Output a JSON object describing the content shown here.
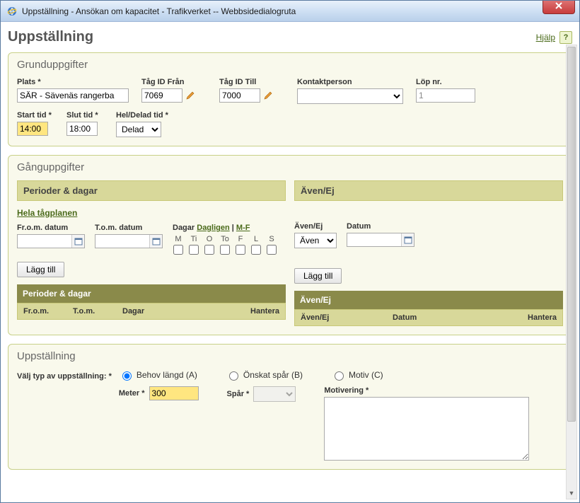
{
  "window": {
    "title": "Uppställning - Ansökan om kapacitet - Trafikverket -- Webbsidedialogruta",
    "close_label": "x"
  },
  "header": {
    "title": "Uppställning",
    "help_link": "Hjälp",
    "help_btn": "?"
  },
  "grund": {
    "legend": "Grunduppgifter",
    "plats_label": "Plats *",
    "plats_value": "SÄR - Sävenäs rangerba",
    "tag_fran_label": "Tåg ID Från",
    "tag_fran_value": "7069",
    "tag_till_label": "Tåg ID Till",
    "tag_till_value": "7000",
    "kontakt_label": "Kontaktperson",
    "kontakt_value": "",
    "lop_label": "Löp nr.",
    "lop_value": "1",
    "start_label": "Start tid *",
    "start_value": "14:00",
    "slut_label": "Slut tid *",
    "slut_value": "18:00",
    "heldelad_label": "Hel/Delad tid *",
    "heldelad_value": "Delad"
  },
  "gang": {
    "legend": "Gånguppgifter",
    "perioder_head": "Perioder & dagar",
    "avenej_head": "Även/Ej",
    "whole_plan": "Hela tågplanen",
    "from_label": "Fr.o.m. datum",
    "tom_label": "T.o.m. datum",
    "dagar_label": "Dagar",
    "dagligen": "Dagligen",
    "mf": "M-F",
    "days": [
      "M",
      "Ti",
      "O",
      "To",
      "F",
      "L",
      "S"
    ],
    "lagg_till": "Lägg till",
    "avenej_label": "Även/Ej",
    "avenej_value": "Även",
    "datum_label": "Datum",
    "grid_left_title": "Perioder & dagar",
    "grid_left_cols": {
      "c1": "Fr.o.m.",
      "c2": "T.o.m.",
      "c3": "Dagar",
      "c4": "Hantera"
    },
    "grid_right_title": "Även/Ej",
    "grid_right_cols": {
      "c1": "Även/Ej",
      "c2": "Datum",
      "c3": "Hantera"
    }
  },
  "upp": {
    "legend": "Uppställning",
    "choose_label": "Välj typ av uppställning: *",
    "opt_a": "Behov längd (A)",
    "opt_b": "Önskat spår (B)",
    "opt_c": "Motiv (C)",
    "meter_label": "Meter *",
    "meter_value": "300",
    "spar_label": "Spår *",
    "spar_value": "",
    "motiv_label": "Motivering *",
    "motiv_value": ""
  },
  "colors": {
    "accent_green": "#4a6a1a",
    "panel_bg": "#f9f9ec",
    "highlight": "#ffe680"
  }
}
